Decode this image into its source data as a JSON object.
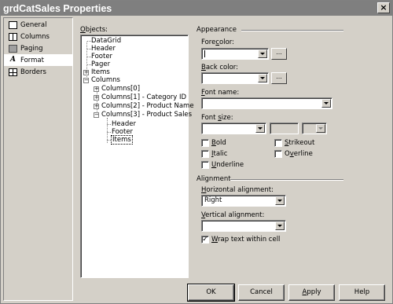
{
  "window": {
    "title": "grdCatSales Properties",
    "close_glyph": "×"
  },
  "nav": {
    "items": [
      {
        "label": "General",
        "icon": "general-icon",
        "selected": false
      },
      {
        "label": "Columns",
        "icon": "columns-icon",
        "selected": false
      },
      {
        "label": "Paging",
        "icon": "paging-icon",
        "selected": false
      },
      {
        "label": "Format",
        "icon": "format-icon",
        "selected": true
      },
      {
        "label": "Borders",
        "icon": "borders-icon",
        "selected": false
      }
    ]
  },
  "objects": {
    "label_u": "O",
    "label_rest": "bjects:",
    "tree": [
      {
        "label": "DataGrid"
      },
      {
        "label": "Header"
      },
      {
        "label": "Footer"
      },
      {
        "label": "Pager"
      },
      {
        "label": "Items",
        "expander": "+"
      },
      {
        "label": "Columns",
        "expander": "−"
      },
      {
        "label": "Columns[0]",
        "expander": "+"
      },
      {
        "label": "Columns[1] - Category ID",
        "expander": "+"
      },
      {
        "label": "Columns[2] - Product Name",
        "expander": "+"
      },
      {
        "label": "Columns[3] - Product Sales",
        "expander": "−"
      },
      {
        "label": "Header"
      },
      {
        "label": "Footer"
      },
      {
        "label": "Items",
        "selected": true
      }
    ]
  },
  "appearance": {
    "group_label": "Appearance",
    "forecolor": {
      "pre": "Fore",
      "u": "c",
      "post": "olor:",
      "value": "",
      "button": "..."
    },
    "backcolor": {
      "pre": "",
      "u": "B",
      "post": "ack color:",
      "value": "",
      "button": "..."
    },
    "fontname": {
      "pre": "",
      "u": "F",
      "post": "ont name:",
      "value": ""
    },
    "fontsize": {
      "pre": "Font ",
      "u": "s",
      "post": "ize:",
      "value": ""
    },
    "checks": {
      "bold": {
        "u": "B",
        "rest": "old",
        "checked": false
      },
      "italic": {
        "u": "I",
        "rest": "talic",
        "checked": false
      },
      "underline": {
        "u": "U",
        "rest": "nderline",
        "checked": false
      },
      "strikeout": {
        "u": "S",
        "rest": "trikeout",
        "checked": false
      },
      "overline": {
        "u": "v",
        "pre": "O",
        "rest": "erline",
        "checked": false
      }
    }
  },
  "alignment": {
    "group_label": "Alignment",
    "horizontal": {
      "u": "H",
      "rest": "orizontal alignment:",
      "value": "Right"
    },
    "vertical": {
      "u": "V",
      "rest": "ertical alignment:",
      "value": ""
    },
    "wrap": {
      "u": "W",
      "rest": "rap text within cell",
      "checked": true,
      "mark": "✓"
    }
  },
  "buttons": {
    "ok": "OK",
    "cancel": "Cancel",
    "apply_u": "A",
    "apply_rest": "pply",
    "help": "Help"
  }
}
